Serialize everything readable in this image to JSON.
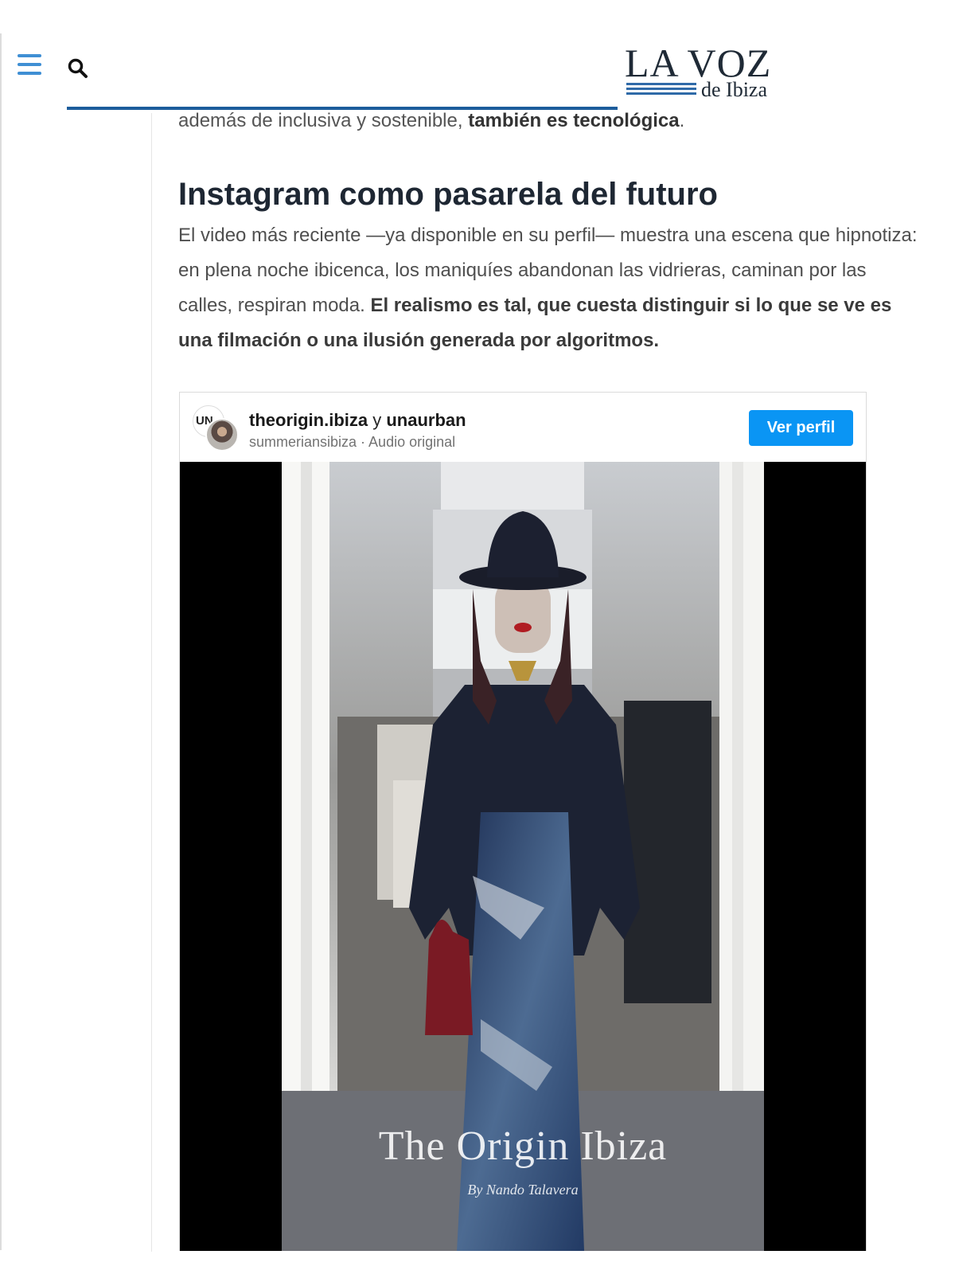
{
  "header": {
    "logo_title": "LA VOZ",
    "logo_subtitle": "de Ibiza",
    "menu_icon": "hamburger-menu-icon",
    "search_icon": "search-icon",
    "accent_color": "#1d5d9c"
  },
  "article": {
    "lead_text_plain": "además de inclusiva y sostenible, ",
    "lead_text_bold": "también es tecnológica",
    "lead_text_end": ".",
    "section_heading": "Instagram como pasarela del futuro",
    "paragraph_plain": "El video más reciente —ya disponible en su perfil— muestra una escena que hipnotiza: en plena noche ibicenca, los maniquíes abandonan las vidrieras, caminan por las calles, respiran moda. ",
    "paragraph_bold": "El realismo es tal, que cuesta distinguir si lo que se ve es una filmación o una ilusión generada por algoritmos."
  },
  "instagram_embed": {
    "avatar_initials": "UN",
    "user_one": "theorigin.ibiza",
    "connector": " y ",
    "user_two": "unaurban",
    "audio_line": "summeriansibiza · Audio original",
    "profile_button": "Ver perfil",
    "button_color": "#0a95f4",
    "video_watermark": "The Origin Ibiza",
    "video_credit": "By Nando Talavera"
  }
}
